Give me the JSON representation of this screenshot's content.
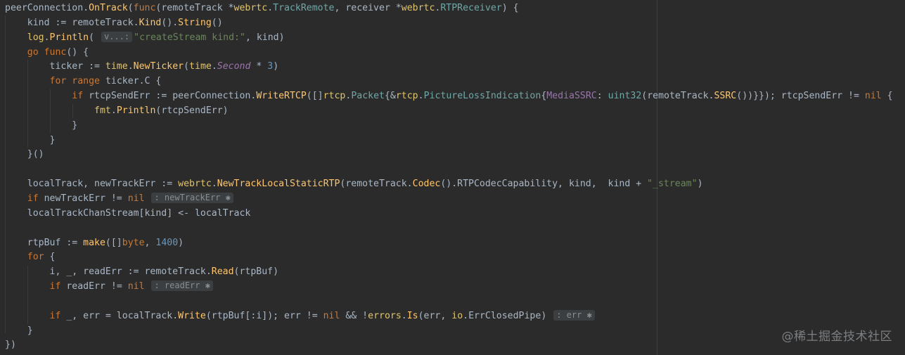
{
  "lines": [
    [
      [
        "peerConnection.",
        "op"
      ],
      [
        "OnTrack",
        "fn"
      ],
      [
        "(",
        "op"
      ],
      [
        "func",
        "kw"
      ],
      [
        "(remoteTrack *",
        "op"
      ],
      [
        "webrtc",
        "pkg"
      ],
      [
        ".",
        "op"
      ],
      [
        "TrackRemote",
        "type"
      ],
      [
        ", receiver *",
        "op"
      ],
      [
        "webrtc",
        "pkg"
      ],
      [
        ".",
        "op"
      ],
      [
        "RTPReceiver",
        "type"
      ],
      [
        ") {",
        "op"
      ]
    ],
    [
      [
        "    kind := remoteTrack.",
        "op"
      ],
      [
        "Kind",
        "fn"
      ],
      [
        "().",
        "op"
      ],
      [
        "String",
        "fn"
      ],
      [
        "()",
        "op"
      ]
    ],
    [
      [
        "    ",
        "op"
      ],
      [
        "log",
        "pkg"
      ],
      [
        ".",
        "op"
      ],
      [
        "Println",
        "fn"
      ],
      [
        "( ",
        "op"
      ],
      [
        "v...:",
        "hint"
      ],
      [
        "\"createStream kind:\"",
        "str"
      ],
      [
        ", kind)",
        "op"
      ]
    ],
    [
      [
        "    ",
        "op"
      ],
      [
        "go func",
        "kw"
      ],
      [
        "() {",
        "op"
      ]
    ],
    [
      [
        "        ticker := ",
        "op"
      ],
      [
        "time",
        "pkg"
      ],
      [
        ".",
        "op"
      ],
      [
        "NewTicker",
        "fn"
      ],
      [
        "(",
        "op"
      ],
      [
        "time",
        "pkg"
      ],
      [
        ".",
        "op"
      ],
      [
        "Second",
        "const"
      ],
      [
        " * ",
        "op"
      ],
      [
        "3",
        "num"
      ],
      [
        ")",
        "op"
      ]
    ],
    [
      [
        "        ",
        "op"
      ],
      [
        "for range",
        "kw"
      ],
      [
        " ticker.C {",
        "op"
      ]
    ],
    [
      [
        "            ",
        "op"
      ],
      [
        "if",
        "kw"
      ],
      [
        " rtcpSendErr := peerConnection.",
        "op"
      ],
      [
        "WriteRTCP",
        "fn"
      ],
      [
        "([]",
        "op"
      ],
      [
        "rtcp",
        "pkg"
      ],
      [
        ".",
        "op"
      ],
      [
        "Packet",
        "type"
      ],
      [
        "{&",
        "op"
      ],
      [
        "rtcp",
        "pkg"
      ],
      [
        ".",
        "op"
      ],
      [
        "PictureLossIndication",
        "type"
      ],
      [
        "{",
        "op"
      ],
      [
        "MediaSSRC",
        "field"
      ],
      [
        ": ",
        "op"
      ],
      [
        "uint32",
        "type"
      ],
      [
        "(remoteTrack.",
        "op"
      ],
      [
        "SSRC",
        "fn"
      ],
      [
        "())}}); rtcpSendErr != ",
        "op"
      ],
      [
        "nil",
        "kw"
      ],
      [
        " {",
        "op"
      ]
    ],
    [
      [
        "                ",
        "op"
      ],
      [
        "fmt",
        "pkg"
      ],
      [
        ".",
        "op"
      ],
      [
        "Println",
        "fn"
      ],
      [
        "(rtcpSendErr)",
        "op"
      ]
    ],
    [
      [
        "            }",
        "op"
      ]
    ],
    [
      [
        "        }",
        "op"
      ]
    ],
    [
      [
        "    }()",
        "op"
      ]
    ],
    [
      [
        "",
        "op"
      ]
    ],
    [
      [
        "    localTrack, newTrackErr := ",
        "op"
      ],
      [
        "webrtc",
        "pkg"
      ],
      [
        ".",
        "op"
      ],
      [
        "NewTrackLocalStaticRTP",
        "fn"
      ],
      [
        "(remoteTrack.",
        "op"
      ],
      [
        "Codec",
        "fn"
      ],
      [
        "().RTPCodecCapability, kind,  kind + ",
        "op"
      ],
      [
        "\"_stream\"",
        "str"
      ],
      [
        ")",
        "op"
      ]
    ],
    [
      [
        "    ",
        "op"
      ],
      [
        "if",
        "kw"
      ],
      [
        " newTrackErr != ",
        "op"
      ],
      [
        "nil",
        "kw"
      ],
      [
        " ",
        "op"
      ],
      [
        ": newTrackErr ✱",
        "hint"
      ]
    ],
    [
      [
        "    localTrackChanStream[kind] <- localTrack",
        "op"
      ]
    ],
    [
      [
        "",
        "op"
      ]
    ],
    [
      [
        "    rtpBuf := ",
        "op"
      ],
      [
        "make",
        "fn"
      ],
      [
        "([]",
        "op"
      ],
      [
        "byte",
        "kw"
      ],
      [
        ", ",
        "op"
      ],
      [
        "1400",
        "num"
      ],
      [
        ")",
        "op"
      ]
    ],
    [
      [
        "    ",
        "op"
      ],
      [
        "for",
        "kw"
      ],
      [
        " {",
        "op"
      ]
    ],
    [
      [
        "        i, _, readErr := remoteTrack.",
        "op"
      ],
      [
        "Read",
        "fn"
      ],
      [
        "(rtpBuf)",
        "op"
      ]
    ],
    [
      [
        "        ",
        "op"
      ],
      [
        "if",
        "kw"
      ],
      [
        " readErr != ",
        "op"
      ],
      [
        "nil",
        "kw"
      ],
      [
        " ",
        "op"
      ],
      [
        ": readErr ✱",
        "hint"
      ]
    ],
    [
      [
        "",
        "op"
      ]
    ],
    [
      [
        "        ",
        "op"
      ],
      [
        "if",
        "kw"
      ],
      [
        " _, err = localTrack.",
        "op"
      ],
      [
        "Write",
        "fn"
      ],
      [
        "(rtpBuf[:i]); err != ",
        "op"
      ],
      [
        "nil",
        "kw"
      ],
      [
        " && !",
        "op"
      ],
      [
        "errors",
        "pkg"
      ],
      [
        ".",
        "op"
      ],
      [
        "Is",
        "fn"
      ],
      [
        "(err, ",
        "op"
      ],
      [
        "io",
        "pkg"
      ],
      [
        ".",
        "op"
      ],
      [
        "ErrClosedPipe",
        "op"
      ],
      [
        ") ",
        "op"
      ],
      [
        ": err ✱",
        "hint"
      ]
    ],
    [
      [
        "    }",
        "op"
      ]
    ],
    [
      [
        "})",
        "op"
      ]
    ]
  ],
  "watermark": "@稀土掘金技术社区",
  "colors": {
    "background": "#2b2b2b",
    "keyword": "#cc7832",
    "function": "#ffc66d",
    "package": "#e0c46c",
    "type": "#6fa8a8",
    "string": "#6a8759",
    "number": "#6897bb",
    "constant": "#9876aa",
    "plain": "#a9b7c6",
    "hint_background": "#3b3f41",
    "hint_text": "#8a8d8f"
  }
}
